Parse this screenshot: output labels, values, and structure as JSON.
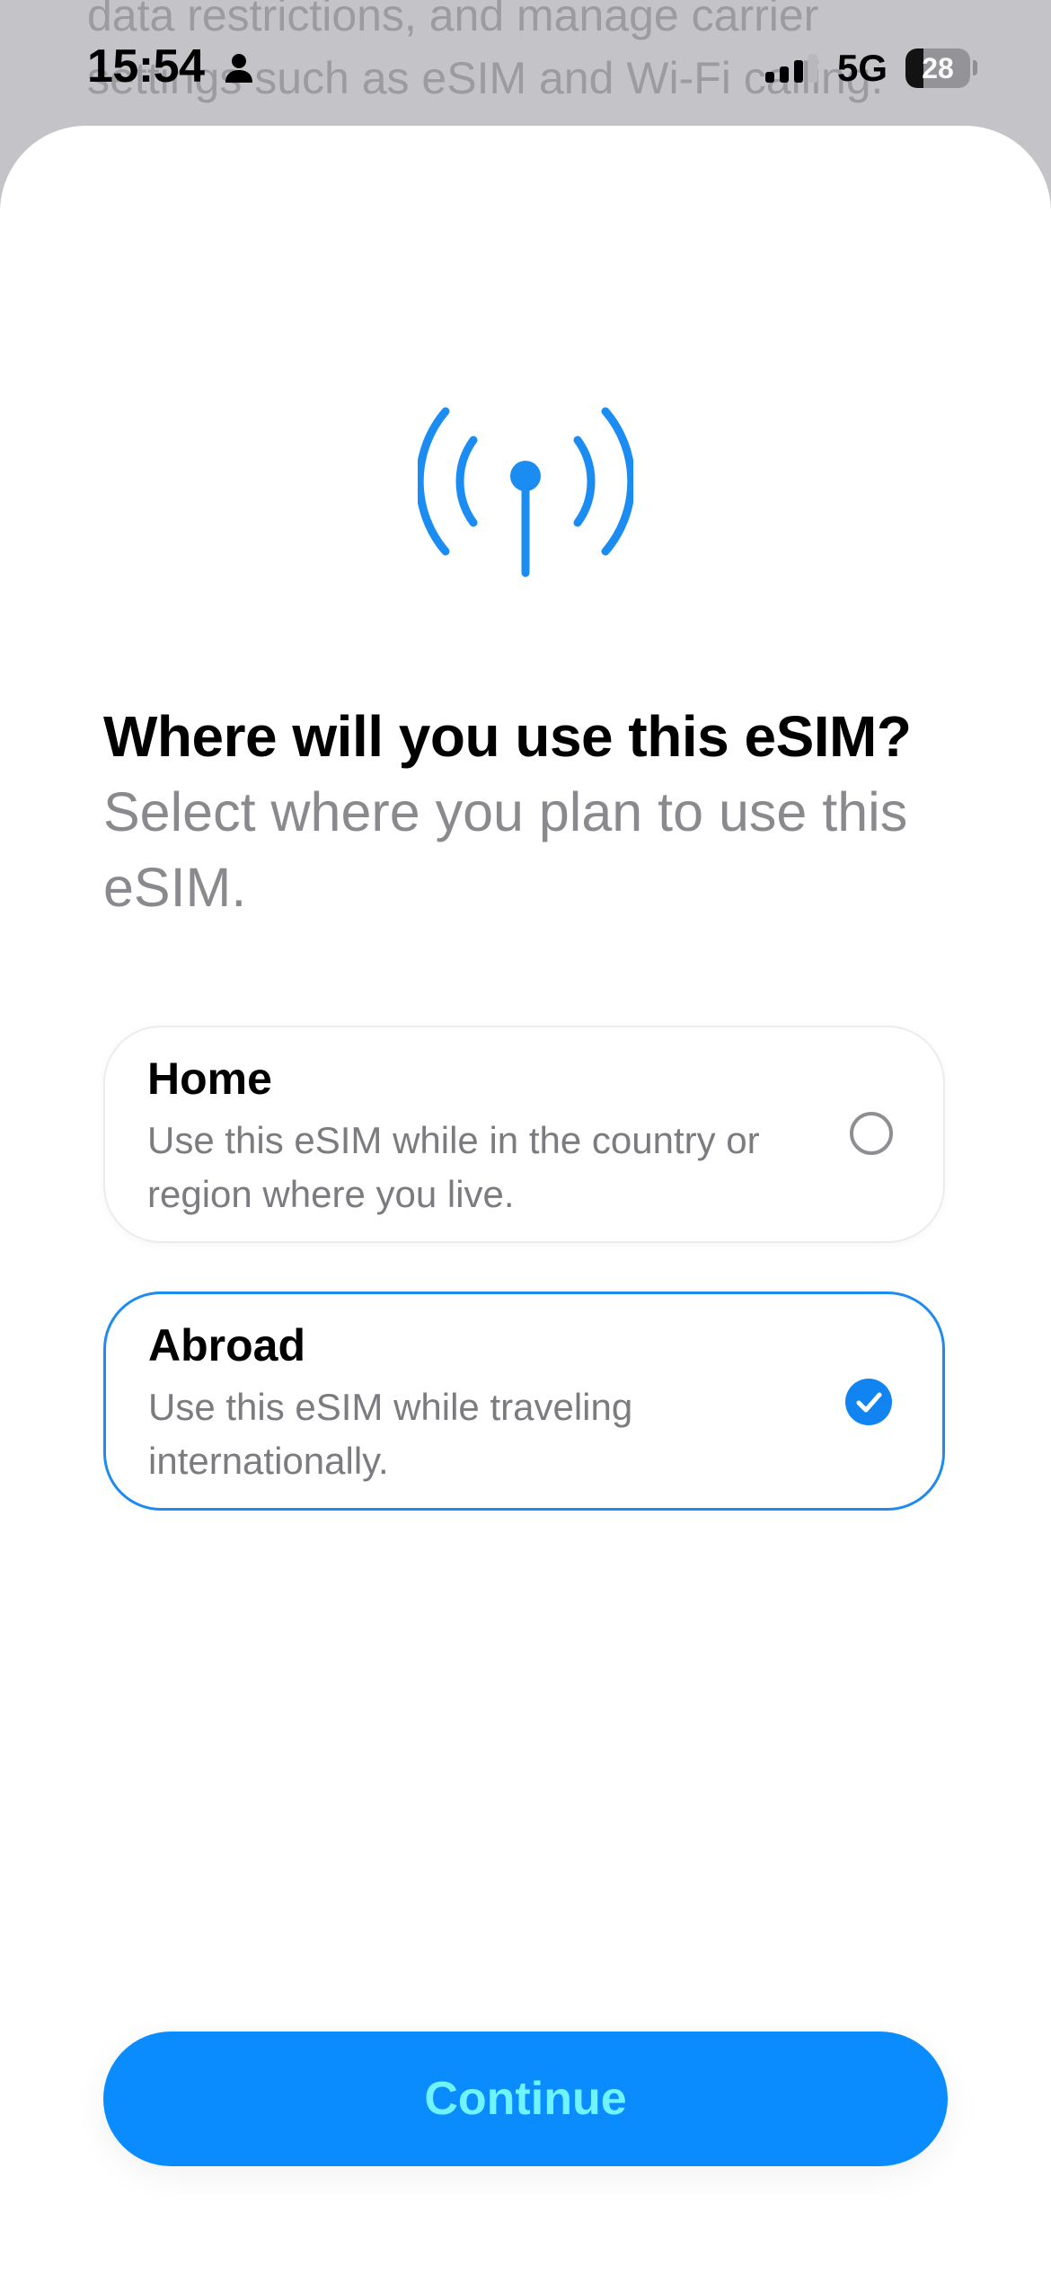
{
  "background_page": {
    "lines": [
      "data restrictions, and manage carrier",
      "settings such as eSIM and Wi-Fi calling."
    ]
  },
  "status_bar": {
    "time": "15:54",
    "network": "5G",
    "battery_level": "28",
    "battery_fraction": 0.28
  },
  "sheet": {
    "icon": "antenna-radiowaves-icon",
    "title": "Where will you use this eSIM?",
    "subtitle": "Select where you plan to use this eSIM.",
    "options": [
      {
        "title": "Home",
        "description": "Use this eSIM while in the country or region where you live.",
        "selected": false
      },
      {
        "title": "Abroad",
        "description": "Use this eSIM while traveling internationally.",
        "selected": true
      }
    ],
    "continue_label": "Continue"
  },
  "colors": {
    "accent": "#0A8CFF",
    "selected_border": "#1F8BF0",
    "continue_text": "#6FF3FF",
    "secondary_text": "#8A8A8E"
  }
}
